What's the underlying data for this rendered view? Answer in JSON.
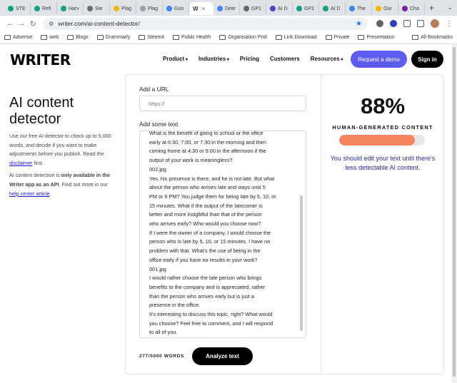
{
  "browser": {
    "tabs": [
      {
        "label": "STE",
        "color": "#10a37f"
      },
      {
        "label": "Refi",
        "color": "#10a37f"
      },
      {
        "label": "Harv",
        "color": "#10a37f"
      },
      {
        "label": "Ste",
        "color": "#6c6c6c"
      },
      {
        "label": "Plag",
        "color": "#f4b400"
      },
      {
        "label": "Plag",
        "color": "#9e9e9e"
      },
      {
        "label": "Goo",
        "color": "#4285f4"
      },
      {
        "label": "Dete",
        "color": "#4285f4"
      },
      {
        "label": "GP1",
        "color": "#666666"
      },
      {
        "label": "AI D",
        "color": "#5a3fc0"
      },
      {
        "label": "GP1",
        "color": "#10a37f"
      },
      {
        "label": "AI D",
        "color": "#10a37f"
      },
      {
        "label": "The",
        "color": "#4285f4"
      },
      {
        "label": "Our",
        "color": "#f4b400"
      },
      {
        "label": "Cha",
        "color": "#7b1fa2"
      }
    ],
    "active_tab": {
      "icon": "W"
    },
    "url": "writer.com/ai-content-detector/",
    "bookmarks": [
      "Adsense",
      "web",
      "Blogs",
      "Grammarly",
      "Steemit",
      "Public Health",
      "Organisation Prof",
      "Link Download",
      "Private",
      "Presentation"
    ],
    "all_bookmarks": "All Bookmarks"
  },
  "header": {
    "logo": "WRITER",
    "nav": [
      "Product",
      "Industries",
      "Pricing",
      "Customers",
      "Resources"
    ],
    "nav_dropdown": [
      true,
      true,
      false,
      false,
      true
    ],
    "demo_button": "Request a demo",
    "signin_button": "Sign in"
  },
  "left": {
    "title_line1": "AI content",
    "title_line2": "detector",
    "desc_before_link": "Use our free AI detector to check up to 5,000 words, and decide if you want to make adjustments before you publish. Read the ",
    "desc_link": "disclaimer",
    "desc_after_link": " first.",
    "desc2_start": "AI content detection is ",
    "desc2_bold": "only available in the Writer app as an API",
    "desc2_mid": ". Find out more in our ",
    "desc2_link": "help center article",
    "desc2_end": "."
  },
  "form": {
    "url_label": "Add a URL",
    "url_placeholder": "https://",
    "text_label": "Add some text",
    "text_lines": [
      "What is the benefit of going to school or the office",
      "early at 6:30, 7:00, or 7:30 in the morning and then",
      "coming home at 4:30 or 5:00 in the afternoon if the",
      "output of your work is meaningless?",
      "002.jpg",
      "Yes, his presence is there, and he is not late. But what",
      "about the person who arrives late and stays until 5",
      "PM or 6 PM? You judge them for being late by 5, 10, or",
      "15 minutes. What if the output of the latecomer is",
      "better and more insightful than that of the person",
      "who arrives early? Who would you choose now?",
      "If I were the owner of a company, I would choose the",
      "person who is late by 5, 10, or 15 minutes. I have no",
      "problem with that. What's the use of being in the",
      "office early if you have no results in your work?",
      "001.jpg",
      "I would rather choose the late person who brings",
      "benefits to the company and is appreciated, rather",
      "than the person who arrives early but is just a",
      "presence in the office.",
      "It's interesting to discuss this topic, right? What would",
      "you choose? Feel free to comment, and I will respond",
      "to all of you."
    ],
    "word_count": "277/5000 WORDS",
    "analyze_button": "Analyze text"
  },
  "result": {
    "percentage": "88%",
    "label": "HUMAN-GENERATED CONTENT",
    "progress_fraction": 0.88,
    "bar_color": "#f4845f",
    "advice": "You should edit your text until there's less detectable AI content."
  }
}
